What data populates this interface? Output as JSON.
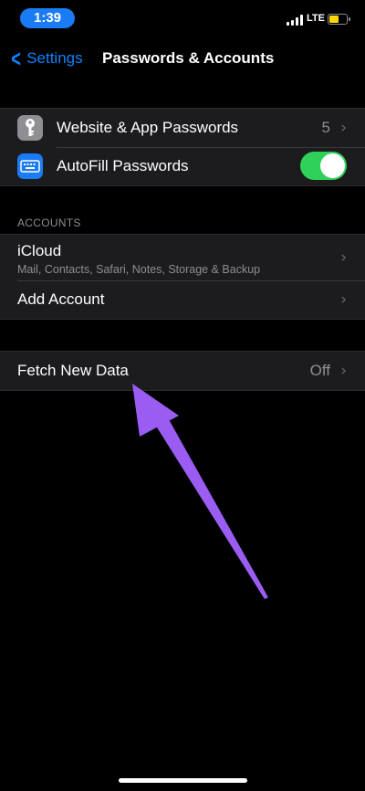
{
  "status_bar": {
    "time": "1:39",
    "network": "LTE",
    "battery_level": 0.6,
    "battery_color": "#ffd60a"
  },
  "nav": {
    "back_label": "Settings",
    "title": "Passwords & Accounts"
  },
  "passwords_group": {
    "items": [
      {
        "label": "Website & App Passwords",
        "detail": "5",
        "icon": "key-icon"
      },
      {
        "label": "AutoFill Passwords",
        "toggle_on": true,
        "icon": "keyboard-icon"
      }
    ]
  },
  "accounts_section": {
    "header": "ACCOUNTS",
    "items": [
      {
        "label": "iCloud",
        "subtitle": "Mail, Contacts, Safari, Notes, Storage & Backup"
      },
      {
        "label": "Add Account"
      }
    ]
  },
  "fetch_group": {
    "label": "Fetch New Data",
    "detail": "Off"
  },
  "colors": {
    "accent": "#0a84ff",
    "toggle_on": "#30d158",
    "annotation_arrow": "#9b5cf2",
    "cell_background": "#1c1c1e"
  }
}
